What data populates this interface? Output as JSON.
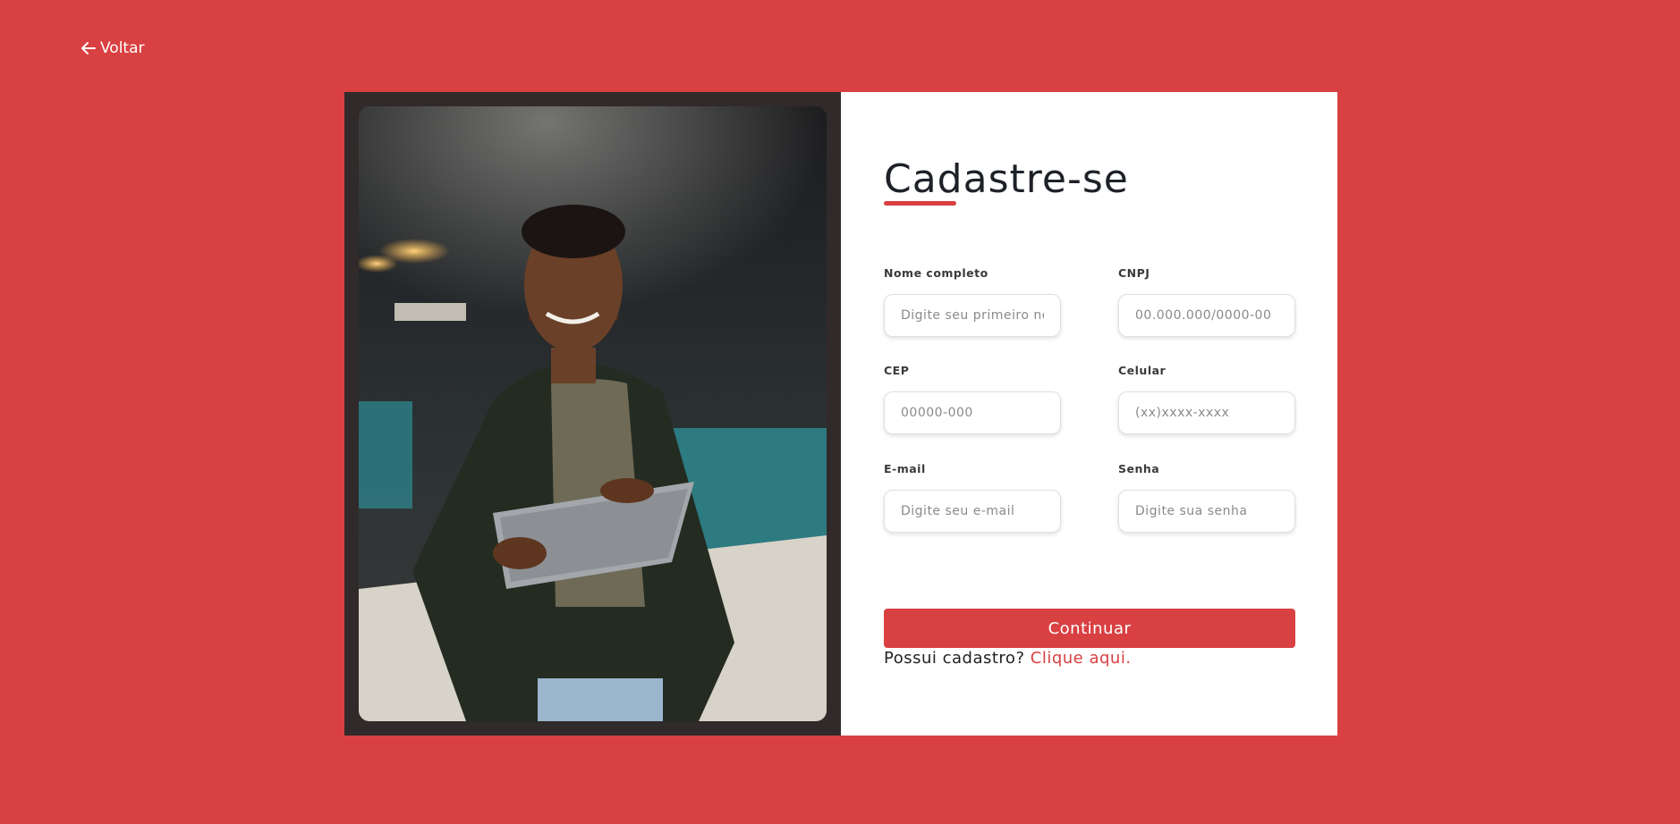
{
  "back": {
    "label": "Voltar",
    "icon": "arrow-left-icon"
  },
  "form": {
    "title": "Cadastre-se",
    "fields": [
      {
        "label": "Nome completo",
        "placeholder": "Digite seu primeiro nome"
      },
      {
        "label": "CNPJ",
        "placeholder": "00.000.000/0000-00"
      },
      {
        "label": "CEP",
        "placeholder": "00000-000"
      },
      {
        "label": "Celular",
        "placeholder": "(xx)xxxx-xxxx"
      },
      {
        "label": "E-mail",
        "placeholder": "Digite seu e-mail"
      },
      {
        "label": "Senha",
        "placeholder": "Digite sua senha"
      }
    ],
    "submit_label": "Continuar",
    "login_prompt": "Possui cadastro?",
    "login_link": "Clique aqui."
  },
  "colors": {
    "background": "#d94042",
    "accent": "#d94042",
    "photo_frame": "#312a2a",
    "title": "#1e2228"
  }
}
